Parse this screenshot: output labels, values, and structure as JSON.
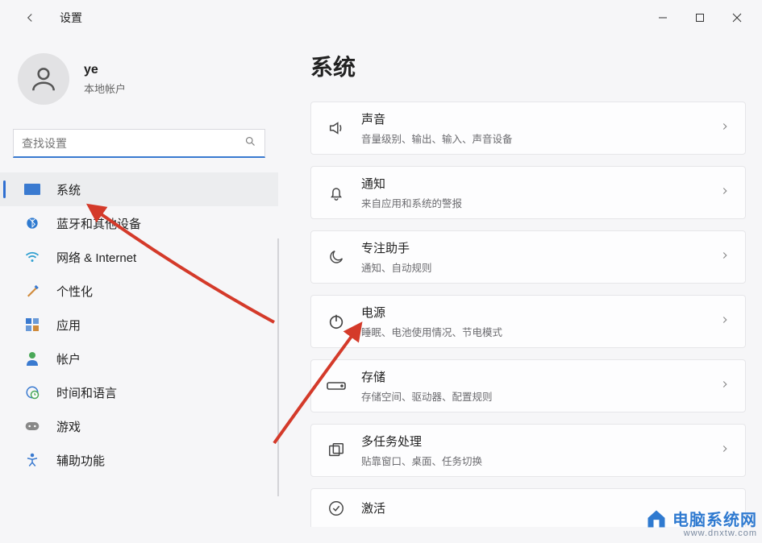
{
  "window": {
    "title": "设置"
  },
  "user": {
    "name": "ye",
    "subtitle": "本地帐户"
  },
  "search": {
    "placeholder": "查找设置"
  },
  "nav": {
    "items": [
      {
        "label": "系统"
      },
      {
        "label": "蓝牙和其他设备"
      },
      {
        "label": "网络 & Internet"
      },
      {
        "label": "个性化"
      },
      {
        "label": "应用"
      },
      {
        "label": "帐户"
      },
      {
        "label": "时间和语言"
      },
      {
        "label": "游戏"
      },
      {
        "label": "辅助功能"
      }
    ]
  },
  "main": {
    "title": "系统",
    "cards": [
      {
        "title": "声音",
        "sub": "音量级别、输出、输入、声音设备"
      },
      {
        "title": "通知",
        "sub": "来自应用和系统的警报"
      },
      {
        "title": "专注助手",
        "sub": "通知、自动规则"
      },
      {
        "title": "电源",
        "sub": "睡眠、电池使用情况、节电模式"
      },
      {
        "title": "存储",
        "sub": "存储空间、驱动器、配置规则"
      },
      {
        "title": "多任务处理",
        "sub": "贴靠窗口、桌面、任务切换"
      },
      {
        "title": "激活",
        "sub": ""
      }
    ]
  },
  "watermark": {
    "title": "电脑系统网",
    "url": "www.dnxtw.com"
  }
}
